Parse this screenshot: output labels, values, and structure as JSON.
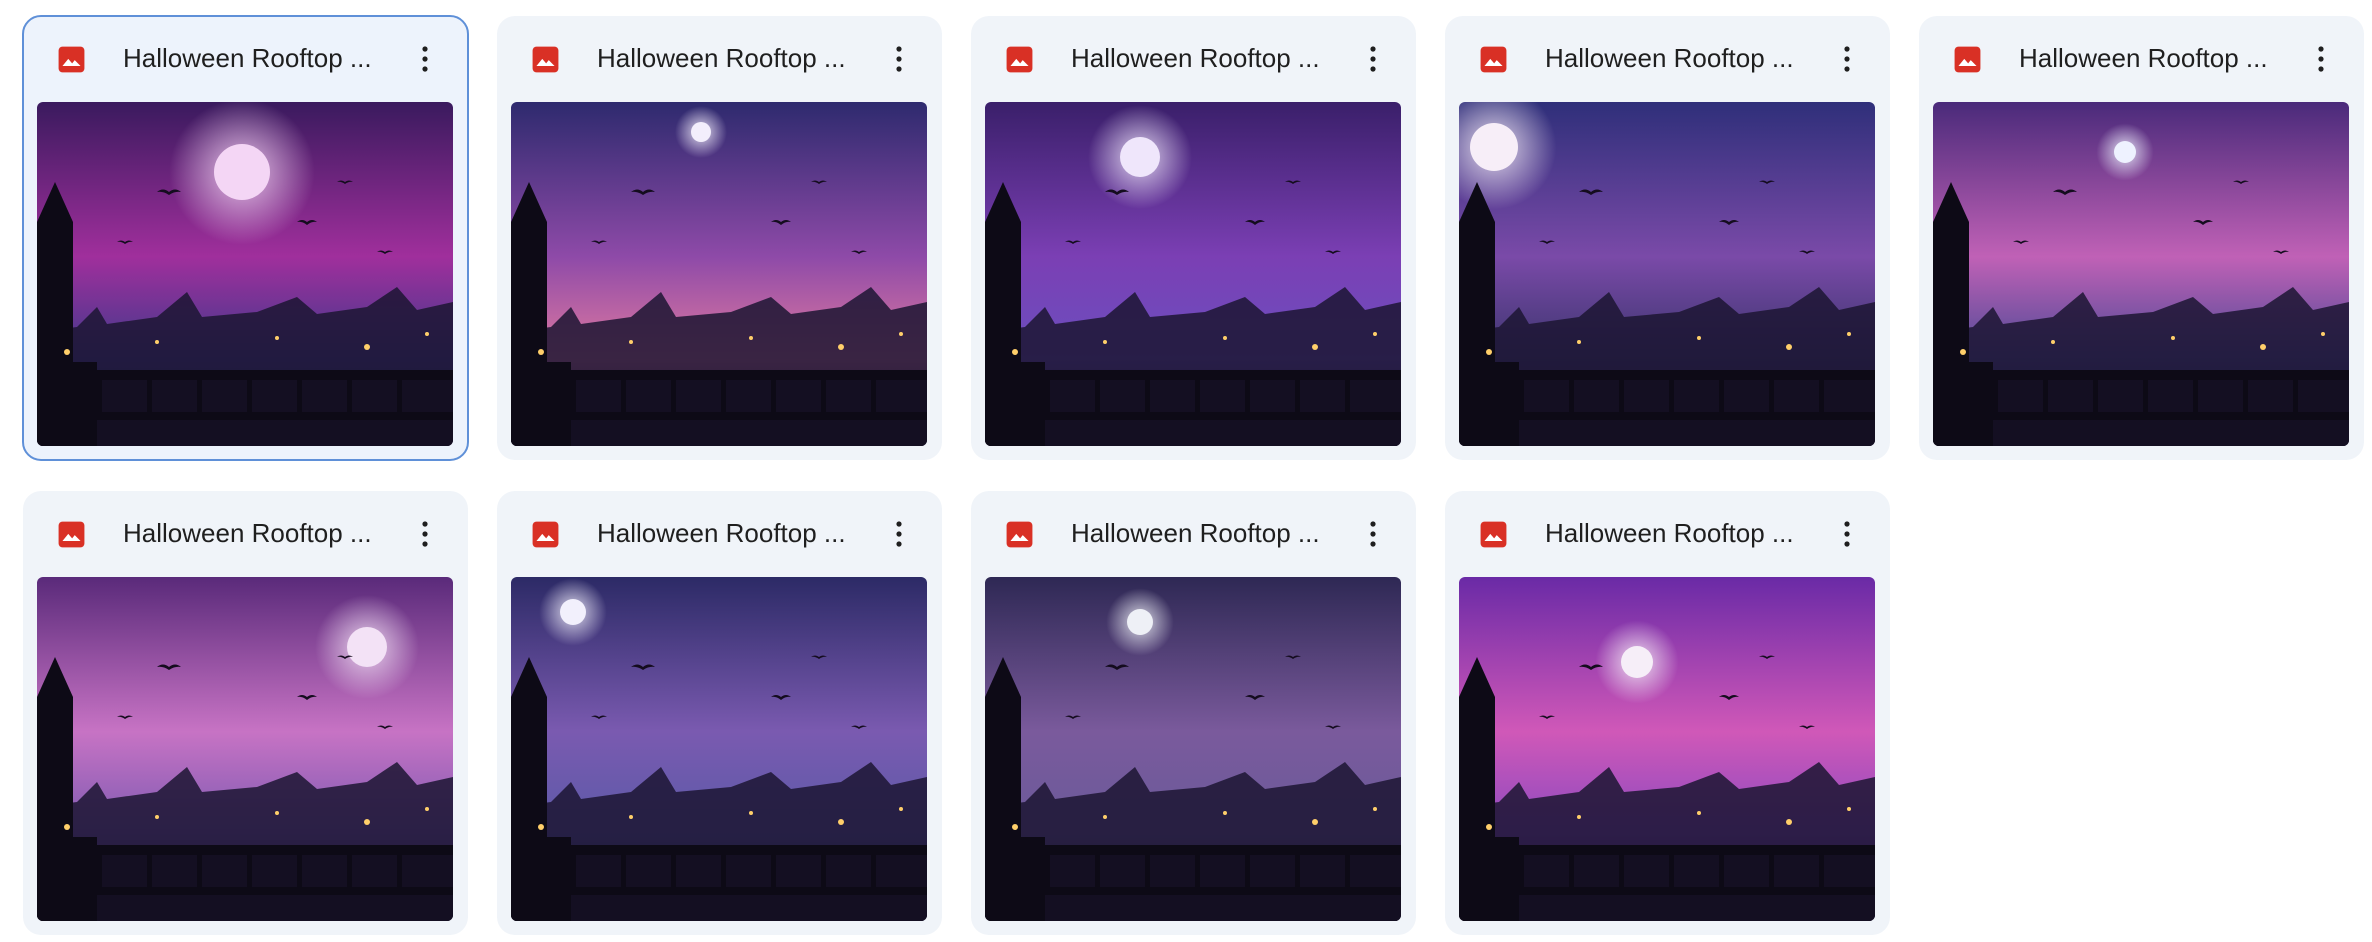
{
  "files": [
    {
      "name": "Halloween Rooftop ...",
      "selected": true,
      "sky_top": "#3a1a5e",
      "sky_mid": "#a02f9c",
      "sky_low": "#3f3a8c",
      "moon": "#f4d6f5"
    },
    {
      "name": "Halloween Rooftop ...",
      "selected": false,
      "sky_top": "#2e2a6e",
      "sky_mid": "#8e4aa8",
      "sky_low": "#e07aa0",
      "moon": "#f3eefc"
    },
    {
      "name": "Halloween Rooftop ...",
      "selected": false,
      "sky_top": "#3a1f6a",
      "sky_mid": "#7b3fb4",
      "sky_low": "#6b4fbf",
      "moon": "#efe6fb"
    },
    {
      "name": "Halloween Rooftop ...",
      "selected": false,
      "sky_top": "#2f2f7a",
      "sky_mid": "#7a4aa8",
      "sky_low": "#3b356e",
      "moon": "#f7eef8"
    },
    {
      "name": "Halloween Rooftop ...",
      "selected": false,
      "sky_top": "#4a2a7a",
      "sky_mid": "#c061b6",
      "sky_low": "#4c4a96",
      "moon": "#eef2ff"
    },
    {
      "name": "Halloween Rooftop ...",
      "selected": false,
      "sky_top": "#5a2a7a",
      "sky_mid": "#c773c4",
      "sky_low": "#7c5ab2",
      "moon": "#f3e2f6"
    },
    {
      "name": "Halloween Rooftop ...",
      "selected": false,
      "sky_top": "#2c2a66",
      "sky_mid": "#7a5ab0",
      "sky_low": "#5b5aa8",
      "moon": "#f2f0fc"
    },
    {
      "name": "Halloween Rooftop ...",
      "selected": false,
      "sky_top": "#2e2854",
      "sky_mid": "#7a5a9c",
      "sky_low": "#6a5a9a",
      "moon": "#eef0f6"
    },
    {
      "name": "Halloween Rooftop ...",
      "selected": false,
      "sky_top": "#6a2aa6",
      "sky_mid": "#d058b8",
      "sky_low": "#8a4ac0",
      "moon": "#f6eef8"
    }
  ],
  "icons": {
    "file_type": "image-icon",
    "menu": "more-vert-icon"
  },
  "colors": {
    "image_icon_red": "#d93025",
    "selection_border": "#5f90d8",
    "card_bg": "#f0f4f9"
  }
}
